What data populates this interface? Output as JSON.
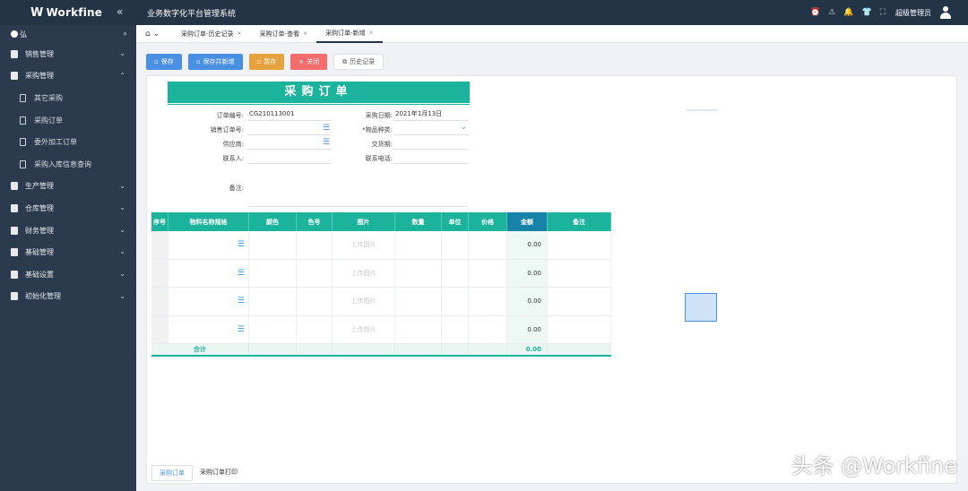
{
  "app": {
    "brand": "Workfine",
    "brand_mark": "W",
    "system_title": "业务数字化平台管理系统",
    "user": "超级管理员"
  },
  "sidebar": {
    "search_prefix": "弘",
    "items": [
      {
        "label": "销售管理",
        "expanded": false
      },
      {
        "label": "采购管理",
        "expanded": true
      },
      {
        "label": "生产管理",
        "expanded": false
      },
      {
        "label": "仓库管理",
        "expanded": false
      },
      {
        "label": "财务管理",
        "expanded": false
      },
      {
        "label": "基础管理",
        "expanded": false
      },
      {
        "label": "基础设置",
        "expanded": false
      },
      {
        "label": "初始化管理",
        "expanded": false
      }
    ],
    "sub_items": [
      "其它采购",
      "采购订单",
      "委外加工订单",
      "采购入库信息查询"
    ]
  },
  "tabs": [
    {
      "label": "采购订单-历史记录",
      "active": false
    },
    {
      "label": "采购订单-查看",
      "active": false
    },
    {
      "label": "采购订单-新增",
      "active": true
    }
  ],
  "toolbar": {
    "save": "保存",
    "save_new": "保存并新增",
    "draft": "暂存",
    "close": "关闭",
    "history": "历史记录"
  },
  "form": {
    "title": "采购订单",
    "order_no_label": "订单编号:",
    "order_no": "CG210113001",
    "purchase_date_label": "采购日期:",
    "purchase_date": "2021年1月13日",
    "sales_order_label": "销售订单号:",
    "sales_order": "",
    "item_type_label": "*物品种类:",
    "item_type": "",
    "supplier_label": "供应商:",
    "supplier": "",
    "delivery_label": "交货期:",
    "delivery": "",
    "contact_label": "联系人:",
    "contact": "",
    "phone_label": "联系电话:",
    "phone": "",
    "remark_label": "备注:",
    "remark": ""
  },
  "grid": {
    "headers": [
      "序号",
      "物料名称规格",
      "颜色",
      "色号",
      "图片",
      "数量",
      "单位",
      "价格",
      "金额",
      "备注"
    ],
    "upload_label": "上传图片",
    "rows": [
      {
        "amount": "0.00"
      },
      {
        "amount": "0.00"
      },
      {
        "amount": "0.00"
      },
      {
        "amount": "0.00"
      }
    ],
    "total_label": "合计",
    "total_amount": "0.00"
  },
  "bottom_tabs": [
    "采购订单",
    "采购订单打印"
  ],
  "watermark": "头条 @Workfine",
  "colors": {
    "topbar": "#243447",
    "sidebar": "#2b3a4d",
    "accent_green": "#1bb39b",
    "accent_blue": "#4a90e2",
    "amount_header": "#1883a8"
  },
  "icons": [
    "collapse-icon",
    "search-icon",
    "home-icon",
    "alarm-icon",
    "warning-icon",
    "bell-icon",
    "shirt-icon",
    "fullscreen-icon",
    "avatar-icon",
    "list-icon",
    "chevron-down-icon"
  ]
}
